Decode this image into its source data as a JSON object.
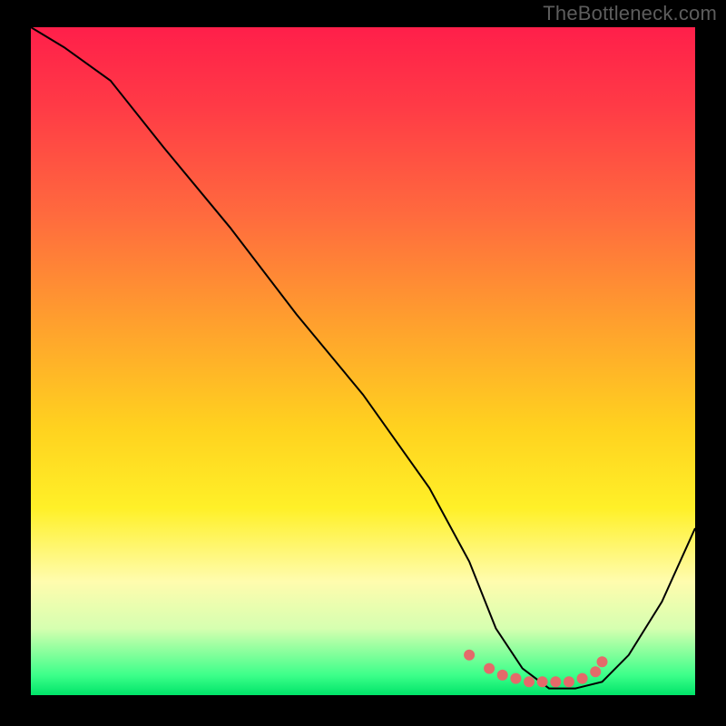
{
  "watermark": "TheBottleneck.com",
  "chart_data": {
    "type": "line",
    "title": "",
    "xlabel": "",
    "ylabel": "",
    "xlim": [
      0,
      100
    ],
    "ylim": [
      0,
      100
    ],
    "grid": false,
    "legend": false,
    "series": [
      {
        "name": "curve",
        "x": [
          0,
          5,
          12,
          20,
          30,
          40,
          50,
          60,
          66,
          70,
          74,
          78,
          82,
          86,
          90,
          95,
          100
        ],
        "values": [
          100,
          97,
          92,
          82,
          70,
          57,
          45,
          31,
          20,
          10,
          4,
          1,
          1,
          2,
          6,
          14,
          25
        ]
      }
    ],
    "markers": {
      "name": "highlight-points",
      "color": "#e46a6a",
      "x": [
        66,
        69,
        71,
        73,
        75,
        77,
        79,
        81,
        83,
        85,
        86
      ],
      "values": [
        6,
        4,
        3,
        2.5,
        2,
        2,
        2,
        2,
        2.5,
        3.5,
        5
      ]
    },
    "background_gradient": {
      "top": "#ff1f4a",
      "upper_mid": "#ffa22d",
      "mid": "#fff028",
      "lower_mid": "#d6ffb0",
      "bottom": "#00e469"
    }
  }
}
